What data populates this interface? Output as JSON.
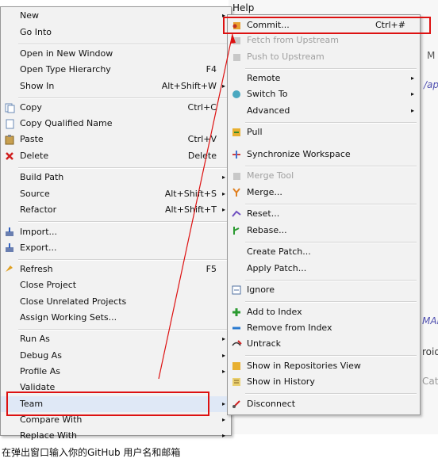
{
  "window": {
    "menubar_help": "Help",
    "bg_m": "M",
    "bg_ap": "/ap",
    "bg_mail": "MAII",
    "bg_roid": "roid",
    "bg_cat": "Cat"
  },
  "context_menu": {
    "items": [
      {
        "label": "New",
        "shortcut": "",
        "arrow": "▸"
      },
      {
        "label": "Go Into",
        "shortcut": ""
      },
      {
        "label": "Open in New Window",
        "shortcut": ""
      },
      {
        "label": "Open Type Hierarchy",
        "shortcut": "F4"
      },
      {
        "label": "Show In",
        "shortcut": "Alt+Shift+W",
        "arrow": "▸"
      },
      {
        "label": "Copy",
        "shortcut": "Ctrl+C"
      },
      {
        "label": "Copy Qualified Name",
        "shortcut": ""
      },
      {
        "label": "Paste",
        "shortcut": "Ctrl+V"
      },
      {
        "label": "Delete",
        "shortcut": "Delete"
      },
      {
        "label": "Build Path",
        "shortcut": "",
        "arrow": "▸"
      },
      {
        "label": "Source",
        "shortcut": "Alt+Shift+S",
        "arrow": "▸"
      },
      {
        "label": "Refactor",
        "shortcut": "Alt+Shift+T",
        "arrow": "▸"
      },
      {
        "label": "Import...",
        "shortcut": ""
      },
      {
        "label": "Export...",
        "shortcut": ""
      },
      {
        "label": "Refresh",
        "shortcut": "F5"
      },
      {
        "label": "Close Project",
        "shortcut": ""
      },
      {
        "label": "Close Unrelated Projects",
        "shortcut": ""
      },
      {
        "label": "Assign Working Sets...",
        "shortcut": ""
      },
      {
        "label": "Run As",
        "shortcut": "",
        "arrow": "▸"
      },
      {
        "label": "Debug As",
        "shortcut": "",
        "arrow": "▸"
      },
      {
        "label": "Profile As",
        "shortcut": "",
        "arrow": "▸"
      },
      {
        "label": "Validate",
        "shortcut": ""
      },
      {
        "label": "Team",
        "shortcut": "",
        "arrow": "▸"
      },
      {
        "label": "Compare With",
        "shortcut": "",
        "arrow": "▸"
      },
      {
        "label": "Replace With",
        "shortcut": "",
        "arrow": "▸"
      }
    ]
  },
  "team_menu": {
    "items": [
      {
        "label": "Commit...",
        "shortcut": "Ctrl+#"
      },
      {
        "label": "Fetch from Upstream",
        "shortcut": ""
      },
      {
        "label": "Push to Upstream",
        "shortcut": ""
      },
      {
        "label": "Remote",
        "shortcut": "",
        "arrow": "▸"
      },
      {
        "label": "Switch To",
        "shortcut": "",
        "arrow": "▸"
      },
      {
        "label": "Advanced",
        "shortcut": "",
        "arrow": "▸"
      },
      {
        "label": "Pull",
        "shortcut": ""
      },
      {
        "label": "Synchronize Workspace",
        "shortcut": ""
      },
      {
        "label": "Merge Tool",
        "shortcut": ""
      },
      {
        "label": "Merge...",
        "shortcut": ""
      },
      {
        "label": "Reset...",
        "shortcut": ""
      },
      {
        "label": "Rebase...",
        "shortcut": ""
      },
      {
        "label": "Create Patch...",
        "shortcut": ""
      },
      {
        "label": "Apply Patch...",
        "shortcut": ""
      },
      {
        "label": "Ignore",
        "shortcut": ""
      },
      {
        "label": "Add to Index",
        "shortcut": ""
      },
      {
        "label": "Remove from Index",
        "shortcut": ""
      },
      {
        "label": "Untrack",
        "shortcut": ""
      },
      {
        "label": "Show in Repositories View",
        "shortcut": ""
      },
      {
        "label": "Show in History",
        "shortcut": ""
      },
      {
        "label": "Disconnect",
        "shortcut": ""
      }
    ]
  },
  "caption": "在弹出窗口输入你的GitHub 用户名和邮箱",
  "colors": {
    "highlight": "#dd1111",
    "menu_bg": "#f2f2f2",
    "disabled": "#a0a0a0"
  }
}
